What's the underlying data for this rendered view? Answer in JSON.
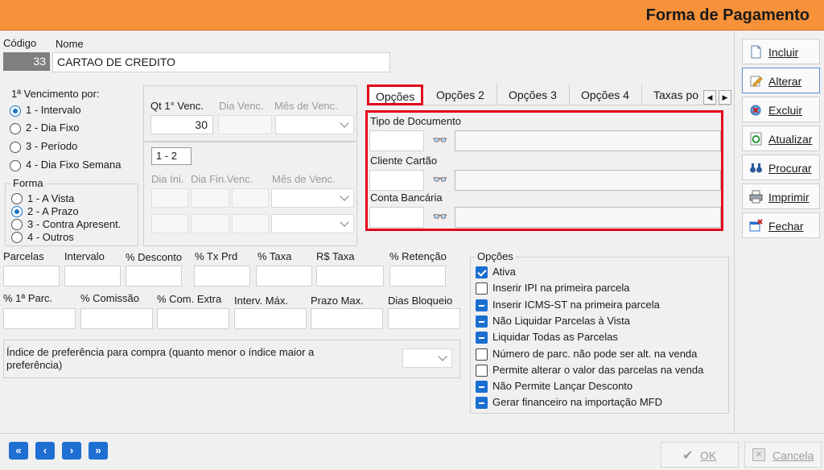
{
  "window": {
    "title": "Forma de Pagamento"
  },
  "header": {
    "codigo_label": "Código",
    "nome_label": "Nome",
    "codigo_value": "33",
    "nome_value": "CARTAO DE CREDITO"
  },
  "vencimento": {
    "title": "1ª Vencimento por:",
    "options": [
      "1 - Intervalo",
      "2 - Dia Fixo",
      "3 - Período",
      "4 - Dia Fixo Semana"
    ],
    "selected": "1 - Intervalo"
  },
  "forma": {
    "title": "Forma",
    "options": [
      "1 - A Vista",
      "2 - A Prazo",
      "3 - Contra Apresent.",
      "4 - Outros"
    ],
    "selected": "2 - A Prazo"
  },
  "venc_panel": {
    "qt_label": "Qt 1° Venc.",
    "qt_value": "30",
    "dia_venc_label": "Dia Venc.",
    "mes_venc_label": "Mês de Venc.",
    "range_value": "1 - 2",
    "dia_ini_label": "Dia Ini.",
    "dia_fin_label": "Dia Fin.Venc.",
    "mes_venc2_label": "Mês de Venc."
  },
  "fields_row1": [
    "Parcelas",
    "Intervalo",
    "% Desconto",
    "% Tx Prd",
    "% Taxa",
    "R$ Taxa",
    "% Retenção"
  ],
  "fields_row2": [
    "% 1ª Parc.",
    "% Comissão",
    "% Com. Extra",
    "Interv. Máx.",
    "Prazo Max.",
    "Dias Bloqueio"
  ],
  "indice": {
    "label": "Índice de preferência para compra (quanto menor o índice maior a preferência)"
  },
  "tabs": [
    "Opções",
    "Opções 2",
    "Opções 3",
    "Opções 4",
    "Taxas po"
  ],
  "tab_panel": {
    "tipo_documento_label": "Tipo de Documento",
    "cliente_cartao_label": "Cliente Cartão",
    "conta_bancaria_label": "Conta Bancária"
  },
  "opcoes": {
    "title": "Opções",
    "items": [
      {
        "label": "Ativa",
        "state": "checked"
      },
      {
        "label": "Inserir IPI na primeira parcela",
        "state": "unchecked"
      },
      {
        "label": "Inserir ICMS-ST na primeira parcela",
        "state": "indeterminate"
      },
      {
        "label": "Não Liquidar Parcelas à Vista",
        "state": "indeterminate"
      },
      {
        "label": "Liquidar Todas as Parcelas",
        "state": "indeterminate"
      },
      {
        "label": "Número de parc. não pode ser alt. na venda",
        "state": "unchecked"
      },
      {
        "label": "Permite alterar o valor das parcelas na venda",
        "state": "unchecked"
      },
      {
        "label": "Não Permite Lançar Desconto",
        "state": "indeterminate"
      },
      {
        "label": "Gerar financeiro na importação MFD",
        "state": "indeterminate"
      }
    ]
  },
  "toolbar": {
    "incluir": "Incluir",
    "alterar": "Alterar",
    "excluir": "Excluir",
    "atualizar": "Atualizar",
    "procurar": "Procurar",
    "imprimir": "Imprimir",
    "fechar": "Fechar"
  },
  "footer": {
    "ok": "OK",
    "cancela": "Cancela"
  },
  "colors": {
    "title_bar": "#f7923a",
    "accent": "#1f6fd3",
    "highlight": "#e3001b"
  }
}
